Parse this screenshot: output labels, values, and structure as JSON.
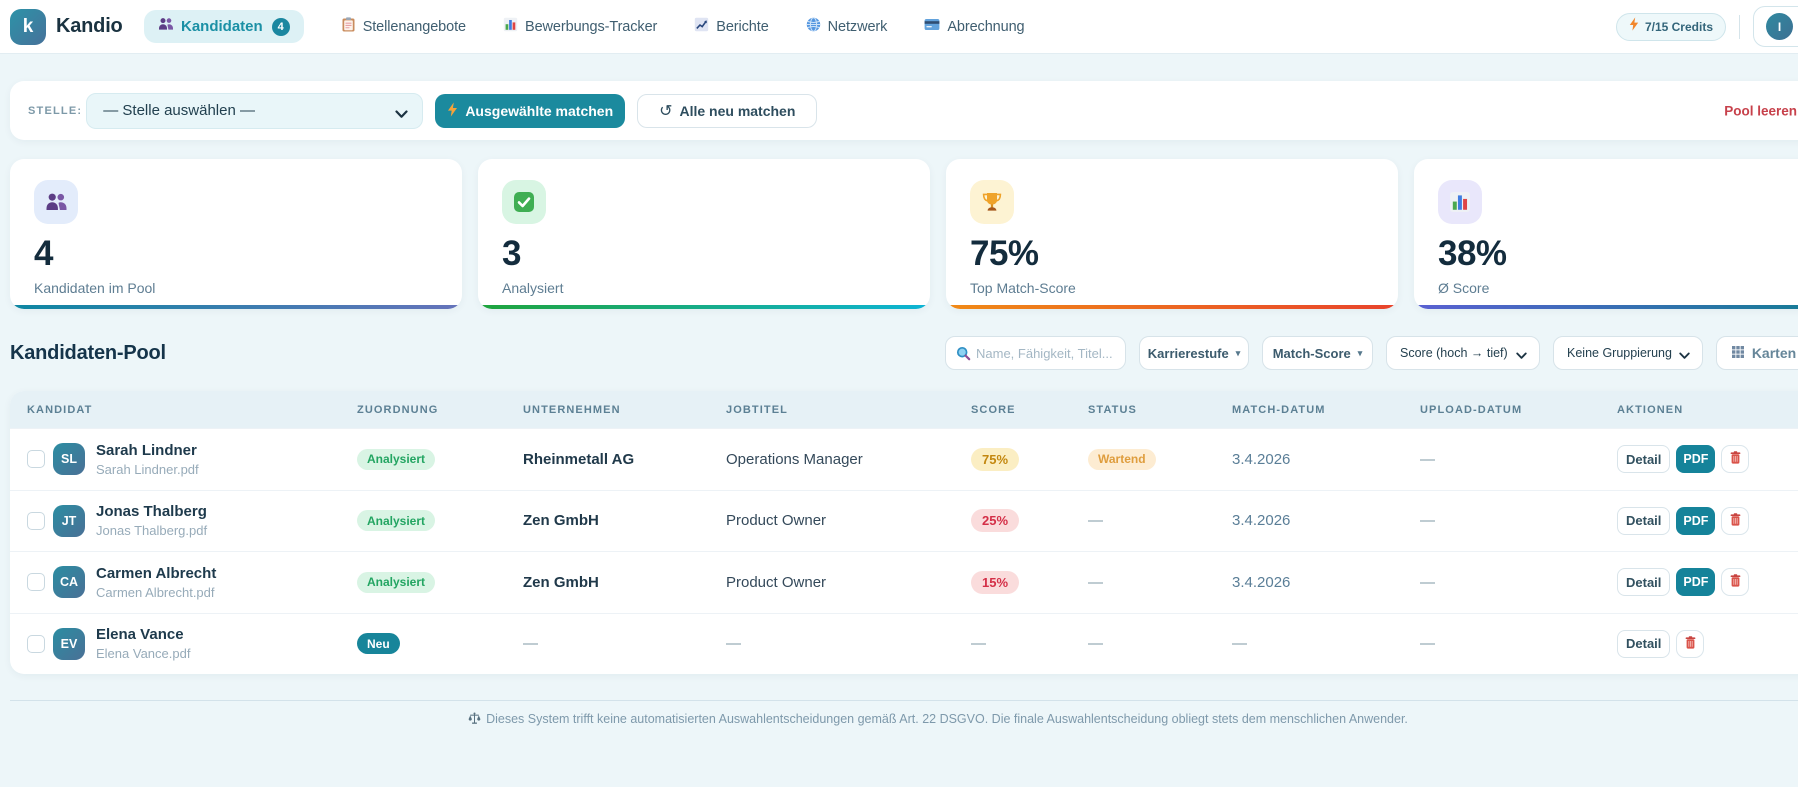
{
  "brand": {
    "logo_letter": "k",
    "name": "Kandio"
  },
  "nav": {
    "active": {
      "label": "Kandidaten",
      "badge": "4"
    },
    "items": [
      {
        "label": "Stellenangebote"
      },
      {
        "label": "Bewerbungs-Tracker"
      },
      {
        "label": "Berichte"
      },
      {
        "label": "Netzwerk"
      },
      {
        "label": "Abrechnung"
      }
    ]
  },
  "header_right": {
    "credits": "7/15 Credits",
    "avatar_initial": "I"
  },
  "filter_bar": {
    "label": "STELLE:",
    "job_select_value": "— Stelle auswählen —",
    "match_selected_label": "Ausgewählte matchen",
    "rematch_all_label": "Alle neu matchen",
    "clear_pool_label": "Pool leeren",
    "refresh_glyph": "↺"
  },
  "stats": [
    {
      "value": "4",
      "label": "Kandidaten im Pool"
    },
    {
      "value": "3",
      "label": "Analysiert"
    },
    {
      "value": "75%",
      "label": "Top Match-Score"
    },
    {
      "value": "38%",
      "label": "Ø Score"
    }
  ],
  "pool": {
    "title": "Kandidaten-Pool",
    "search_placeholder": "Name, Fähigkeit, Titel...",
    "career_filter_label": "Karrierestufe",
    "career_caret": "▾",
    "match_filter_label": "Match-Score",
    "match_caret": "▾",
    "sort_select_value": "Score (hoch → tief)",
    "group_select_value": "Keine Gruppierung",
    "view_toggle_label": "Karten"
  },
  "table": {
    "columns": [
      "KANDIDAT",
      "ZUORDNUNG",
      "UNTERNEHMEN",
      "JOBTITEL",
      "SCORE",
      "STATUS",
      "MATCH-DATUM",
      "UPLOAD-DATUM",
      "AKTIONEN"
    ],
    "rows": [
      {
        "initials": "SL",
        "name": "Sarah Lindner",
        "file": "Sarah Lindner.pdf",
        "assignment": "Analysiert",
        "company": "Rheinmetall AG",
        "job_title": "Operations Manager",
        "score": "75%",
        "status": "Wartend",
        "match_date": "3.4.2026",
        "upload_date": "—",
        "detail_label": "Detail",
        "pdf_label": "PDF"
      },
      {
        "initials": "JT",
        "name": "Jonas Thalberg",
        "file": "Jonas Thalberg.pdf",
        "assignment": "Analysiert",
        "company": "Zen GmbH",
        "job_title": "Product Owner",
        "score": "25%",
        "status": "—",
        "match_date": "3.4.2026",
        "upload_date": "—",
        "detail_label": "Detail",
        "pdf_label": "PDF"
      },
      {
        "initials": "CA",
        "name": "Carmen Albrecht",
        "file": "Carmen Albrecht.pdf",
        "assignment": "Analysiert",
        "company": "Zen GmbH",
        "job_title": "Product Owner",
        "score": "15%",
        "status": "—",
        "match_date": "3.4.2026",
        "upload_date": "—",
        "detail_label": "Detail",
        "pdf_label": "PDF"
      },
      {
        "initials": "EV",
        "name": "Elena Vance",
        "file": "Elena Vance.pdf",
        "assignment": "Neu",
        "company": "—",
        "job_title": "—",
        "score": "—",
        "status": "—",
        "match_date": "—",
        "upload_date": "—",
        "detail_label": "Detail"
      }
    ]
  },
  "footer": {
    "disclaimer": "Dieses System trifft keine automatisierten Auswahlentscheidungen gemäß Art. 22 DSGVO. Die finale Auswahlentscheidung obliegt stets dem menschlichen Anwender."
  }
}
